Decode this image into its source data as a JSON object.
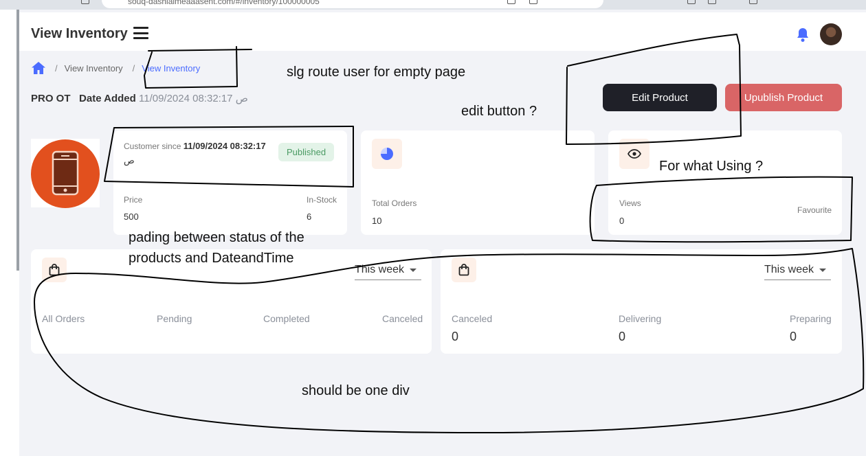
{
  "browser": {
    "url": "souq-dashlaimeaaasent.com/#/inventory/100000005"
  },
  "header": {
    "title": "View Inventory"
  },
  "breadcrumb": {
    "items": [
      "View Inventory",
      "View Inventory"
    ]
  },
  "product": {
    "name": "PRO OT",
    "date_added_label": "Date Added",
    "date_added": "11/09/2024 08:32:17 ص"
  },
  "actions": {
    "edit_label": "Edit Product",
    "unpublish_label": "Upublish Product"
  },
  "info_card": {
    "customer_since_label": "Customer since",
    "customer_since": "11/09/2024 08:32:17",
    "suffix": "ص",
    "status": "Published",
    "price_label": "Price",
    "price": "500",
    "stock_label": "In-Stock",
    "stock": "6"
  },
  "orders_card": {
    "total_orders_label": "Total Orders",
    "total_orders": "10"
  },
  "views_card": {
    "views_label": "Views",
    "views": "0",
    "favourite_label": "Favourite"
  },
  "orders_panel_left": {
    "period": "This week",
    "columns": [
      "All Orders",
      "Pending",
      "Completed",
      "Canceled"
    ]
  },
  "orders_panel_right": {
    "period": "This week",
    "columns": [
      {
        "label": "Canceled",
        "value": "0"
      },
      {
        "label": "Delivering",
        "value": "0"
      },
      {
        "label": "Preparing",
        "value": "0"
      }
    ]
  },
  "annotations": {
    "route": "slg route user for empty page",
    "edit": "edit button ?",
    "using": "For what Using ?",
    "padding_line1": "pading between status of the",
    "padding_line2": "products and DateandTime",
    "one_div": "should be one div"
  },
  "colors": {
    "accent": "#4b6cff",
    "dark_button": "#1f2028",
    "unpublish_button": "#d96566",
    "product_circle": "#e2501e",
    "published_badge": "#e3f3e8"
  },
  "icons": [
    "home-icon",
    "bell-icon",
    "hamburger-icon",
    "phone-icon",
    "pie-icon",
    "eye-icon",
    "bag-icon",
    "caret-down-icon"
  ]
}
